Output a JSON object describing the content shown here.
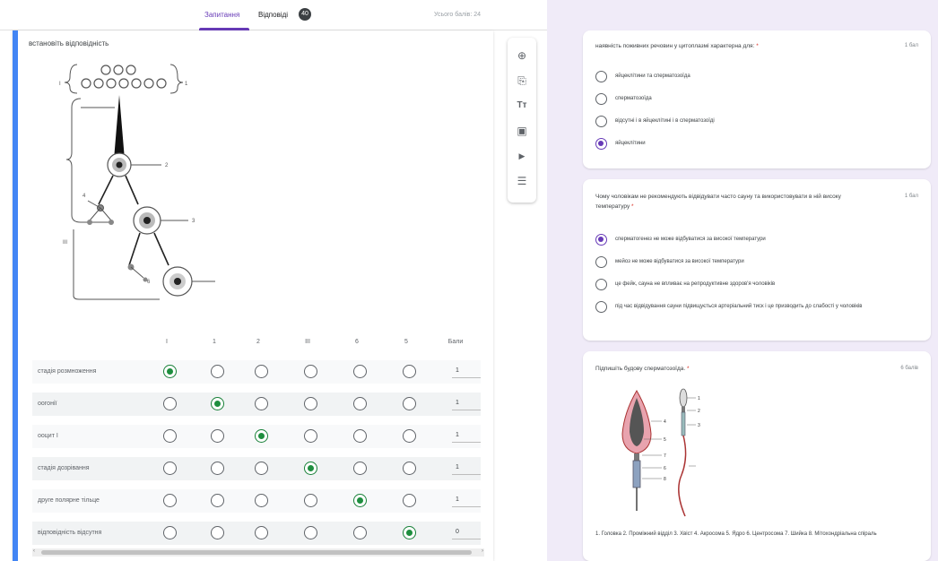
{
  "left": {
    "tabs": {
      "questions": "Запитання",
      "responses": "Відповіді",
      "responses_count": "40",
      "total_points": "Усього балів: 24"
    },
    "question": {
      "title": "встановіть відповідність",
      "columns": [
        "I",
        "1",
        "2",
        "III",
        "6",
        "5",
        "Бали"
      ],
      "rows": [
        {
          "label": "стадія розмноження",
          "selected": 0,
          "points": "1"
        },
        {
          "label": "оогонії",
          "selected": 1,
          "points": "1"
        },
        {
          "label": "ооцит І",
          "selected": 2,
          "points": "1"
        },
        {
          "label": "стадія дозрівання",
          "selected": 3,
          "points": "1"
        },
        {
          "label": "друге полярне тільце",
          "selected": 4,
          "points": "1"
        },
        {
          "label": "відповідність відсутня",
          "selected": 5,
          "points": "0"
        }
      ]
    },
    "scrollbar": {
      "left_arrow": "‹",
      "right_arrow": "›"
    },
    "toolbar": {
      "add_question_icon": "⊕",
      "import_questions_icon": "⎘",
      "add_title_icon": "Tт",
      "add_image_icon": "▣",
      "add_video_icon": "▶",
      "add_section_icon": "☰"
    }
  },
  "right": {
    "card1": {
      "question": "наявність поживних речовин у цитоплазмі характерна для:",
      "required": "*",
      "points": "1 бал",
      "options": [
        {
          "text": "яйцеклітини та сперматозоїда",
          "selected": false
        },
        {
          "text": "сперматозоїда",
          "selected": false
        },
        {
          "text": "відсутні і в яйцеклітині і в сперматозоїді",
          "selected": false
        },
        {
          "text": "яйцеклітини",
          "selected": true
        }
      ]
    },
    "card2": {
      "question": "Чому чоловікам не рекомендують відвідувати часто сауну та використовувати в ній високу температуру",
      "required": "*",
      "points": "1 бал",
      "options": [
        {
          "text": "сперматогенез не може відбуватися за високої температури",
          "selected": true
        },
        {
          "text": "мейоз не може відбуватися за високої температури",
          "selected": false
        },
        {
          "text": "це фейк, сауна не впливає на репродуктивне здоров'я чоловіків",
          "selected": false
        },
        {
          "text": "під час відвідування сауни підвищується артеріальний тиск і це призводить до слабості у чоловіків",
          "selected": false
        }
      ]
    },
    "card3": {
      "question": "Підпишіть будову сперматозоїда.",
      "required": "*",
      "points": "6 балів",
      "caption": "1. Головка 2. Проміжний відділ 3. Хвіст 4. Акросома 5. Ядро 6. Центросома 7. Шийка 8. Мітохондріальна спіраль"
    }
  },
  "colors": {
    "accent": "#673ab7",
    "correct": "#1e8e3e",
    "card_border": "#4285f4",
    "background": "#f0ebf8"
  }
}
